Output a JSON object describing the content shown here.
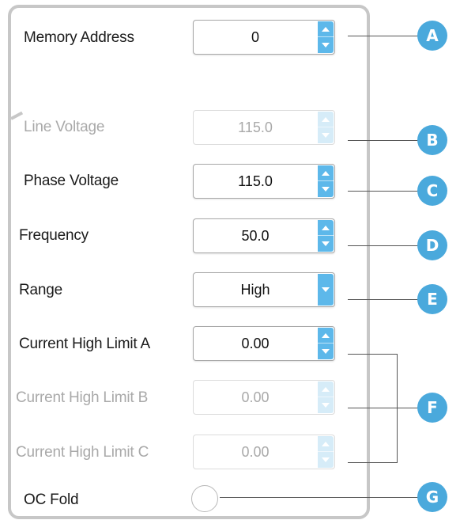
{
  "fields": {
    "memory_address": {
      "label": "Memory Address",
      "value": "0"
    },
    "line_voltage": {
      "label": "Line Voltage",
      "value": "115.0"
    },
    "phase_voltage": {
      "label": "Phase Voltage",
      "value": "115.0"
    },
    "frequency": {
      "label": "Frequency",
      "value": "50.0"
    },
    "range": {
      "label": "Range",
      "value": "High"
    },
    "current_high_limit_a": {
      "label": "Current High Limit A",
      "value": "0.00"
    },
    "current_high_limit_b": {
      "label": "Current High Limit B",
      "value": "0.00"
    },
    "current_high_limit_c": {
      "label": "Current High Limit C",
      "value": "0.00"
    },
    "oc_fold": {
      "label": "OC Fold"
    }
  },
  "callouts": {
    "a": "A",
    "b": "B",
    "c": "C",
    "d": "D",
    "e": "E",
    "f": "F",
    "g": "G"
  },
  "colors": {
    "accent": "#5db8ea",
    "badge": "#4aa9dc",
    "disabled_text": "#a9a9a9"
  }
}
